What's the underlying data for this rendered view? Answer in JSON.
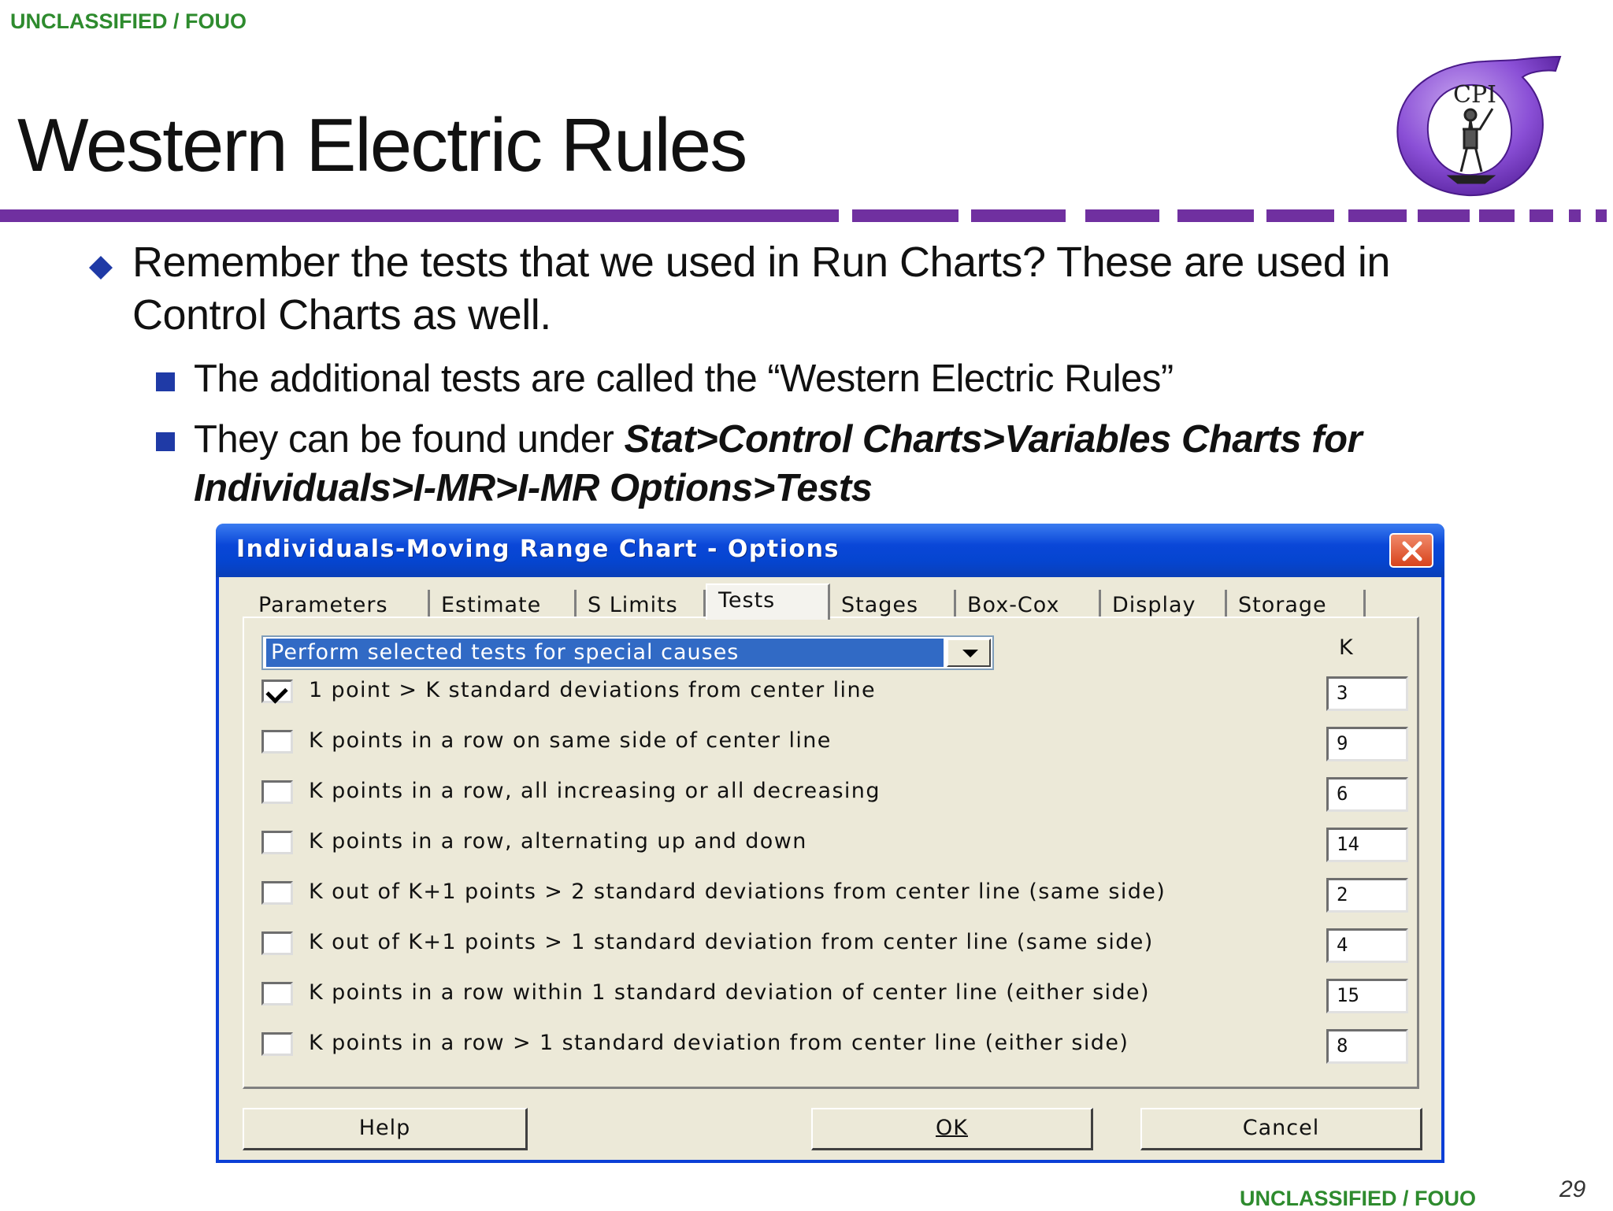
{
  "classification": "UNCLASSIFIED / FOUO",
  "slide": {
    "title": "Western Electric Rules",
    "page_number": "29",
    "bullet1": "Remember the tests that we used in Run Charts?  These are used in Control Charts as well.",
    "bullet2": "The additional tests are called the “Western Electric Rules”",
    "bullet3_prefix": "They can be found under ",
    "bullet3_path": "Stat>Control Charts>Variables Charts for Individuals>I-MR>I-MR Options>Tests",
    "logo_letters": "CPI",
    "accent_color": "#7030a0"
  },
  "dialog": {
    "title": "Individuals-Moving Range Chart - Options",
    "tabs": [
      "Parameters",
      "Estimate",
      "S Limits",
      "Tests",
      "Stages",
      "Box-Cox",
      "Display",
      "Storage"
    ],
    "active_tab": "Tests",
    "dropdown_value": "Perform selected tests for special causes",
    "k_header": "K",
    "tests": [
      {
        "label": "1 point > K standard deviations from center line",
        "k": "3",
        "checked": true
      },
      {
        "label": "K points in a row on same side of center line",
        "k": "9",
        "checked": false
      },
      {
        "label": "K points in a row, all increasing or all decreasing",
        "k": "6",
        "checked": false
      },
      {
        "label": "K points in a row, alternating up and down",
        "k": "14",
        "checked": false
      },
      {
        "label": "K out of K+1 points > 2 standard deviations from center line (same side)",
        "k": "2",
        "checked": false
      },
      {
        "label": "K out of K+1 points > 1 standard deviation from center line (same side)",
        "k": "4",
        "checked": false
      },
      {
        "label": "K points in a row within 1 standard deviation of center line (either side)",
        "k": "15",
        "checked": false
      },
      {
        "label": "K points in a row > 1 standard deviation from center line (either side)",
        "k": "8",
        "checked": false
      }
    ],
    "buttons": {
      "help": "Help",
      "ok": "OK",
      "cancel": "Cancel"
    }
  }
}
